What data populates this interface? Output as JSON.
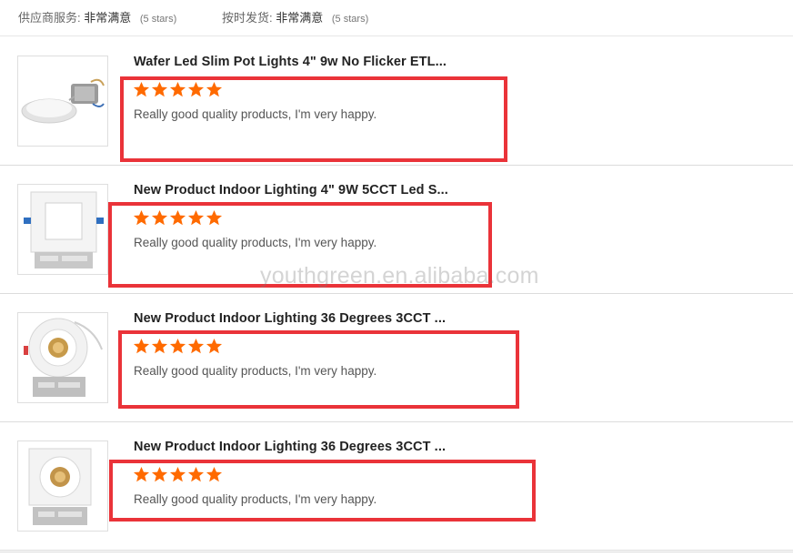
{
  "ratings_bar": {
    "supplier_service": {
      "label": "供应商服务:",
      "value": "非常满意",
      "stars": "(5 stars)"
    },
    "on_time_shipment": {
      "label": "按时发货:",
      "value": "非常满意",
      "stars": "(5 stars)"
    }
  },
  "reviews": [
    {
      "title": "Wafer Led Slim Pot Lights 4\" 9w No Flicker ETL...",
      "rating": 5,
      "comment": "Really good quality products, I'm very happy."
    },
    {
      "title": "New Product Indoor Lighting 4\" 9W 5CCT Led S...",
      "rating": 5,
      "comment": "Really good quality products, I'm very happy."
    },
    {
      "title": "New Product Indoor Lighting 36 Degrees 3CCT ...",
      "rating": 5,
      "comment": "Really good quality products, I'm very happy."
    },
    {
      "title": "New Product Indoor Lighting 36 Degrees 3CCT ...",
      "rating": 5,
      "comment": "Really good quality products, I'm very happy."
    }
  ],
  "watermark": "youthgreen.en.alibaba.com",
  "colors": {
    "star": "#ff6a00",
    "highlight": "#ea3339"
  },
  "icons": {
    "star": "star-icon"
  }
}
